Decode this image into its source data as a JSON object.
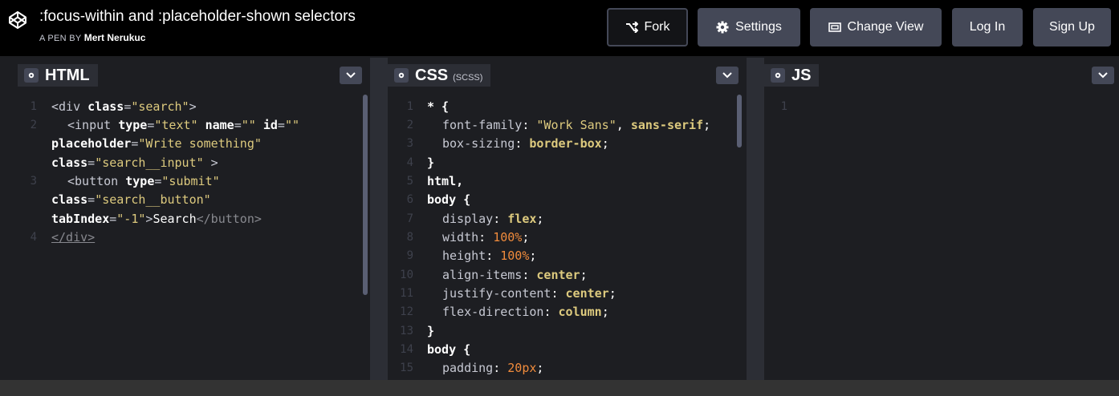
{
  "header": {
    "title": ":focus-within and :placeholder-shown selectors",
    "byline_prefix": "A PEN BY",
    "author": "Mert Nerukuc",
    "buttons": {
      "fork": "Fork",
      "settings": "Settings",
      "change_view": "Change View",
      "login": "Log In",
      "signup": "Sign Up"
    }
  },
  "panes": {
    "html": {
      "label": "HTML",
      "line_numbers": [
        "1",
        "2",
        "3",
        "4"
      ]
    },
    "css": {
      "label": "CSS",
      "sublabel": "(SCSS)",
      "line_numbers": [
        "1",
        "2",
        "3",
        "4",
        "5",
        "6",
        "7",
        "8",
        "9",
        "10",
        "11",
        "12",
        "13",
        "14",
        "15"
      ]
    },
    "js": {
      "label": "JS",
      "line_numbers": [
        "1"
      ]
    }
  },
  "code": {
    "html": {
      "l1a": "<div ",
      "l1b": "class",
      "l1c": "=",
      "l1d": "\"search\"",
      "l1e": ">",
      "l2a": "<input ",
      "l2b": "type",
      "l2c": "=",
      "l2d": "\"text\"",
      "l2e": " ",
      "l2f": "name",
      "l2g": "=",
      "l2h": "\"\"",
      "l2i": " ",
      "l2j": "id",
      "l2k": "=",
      "l2l": "\"\"",
      "l2m": "placeholder",
      "l2n": "=",
      "l2o": "\"Write something\"",
      "l2p": "class",
      "l2q": "=",
      "l2r": "\"search__input\"",
      "l2s": " >",
      "l3a": "<button ",
      "l3b": "type",
      "l3c": "=",
      "l3d": "\"submit\"",
      "l3e": "class",
      "l3f": "=",
      "l3g": "\"search__button\"",
      "l3h": "tabIndex",
      "l3i": "=",
      "l3j": "\"-1\"",
      "l3k": ">",
      "l3l": "Search",
      "l3m": "</button>",
      "l4": "</div>"
    },
    "css": {
      "c1": "* {",
      "c2a": "font-family",
      "c2b": ": ",
      "c2c": "\"Work Sans\"",
      "c2d": ", ",
      "c2e": "sans-serif",
      "c2f": ";",
      "c3a": "box-sizing",
      "c3b": ": ",
      "c3c": "border-box",
      "c3d": ";",
      "c4": "}",
      "c5": "html,",
      "c6": "body {",
      "c7a": "display",
      "c7b": ": ",
      "c7c": "flex",
      "c7d": ";",
      "c8a": "width",
      "c8b": ": ",
      "c8c": "100%",
      "c8d": ";",
      "c9a": "height",
      "c9b": ": ",
      "c9c": "100%",
      "c9d": ";",
      "c10a": "align-items",
      "c10b": ": ",
      "c10c": "center",
      "c10d": ";",
      "c11a": "justify-content",
      "c11b": ": ",
      "c11c": "center",
      "c11d": ";",
      "c12a": "flex-direction",
      "c12b": ": ",
      "c12c": "column",
      "c12d": ";",
      "c13": "}",
      "c14": "body {",
      "c15a": "padding",
      "c15b": ": ",
      "c15c": "20px",
      "c15d": ";"
    }
  },
  "icons": {
    "logo": "codepen-logo-icon",
    "fork": "fork-icon",
    "settings": "gear-icon",
    "change_view": "layout-icon",
    "dropdown": "chevron-down-icon"
  }
}
